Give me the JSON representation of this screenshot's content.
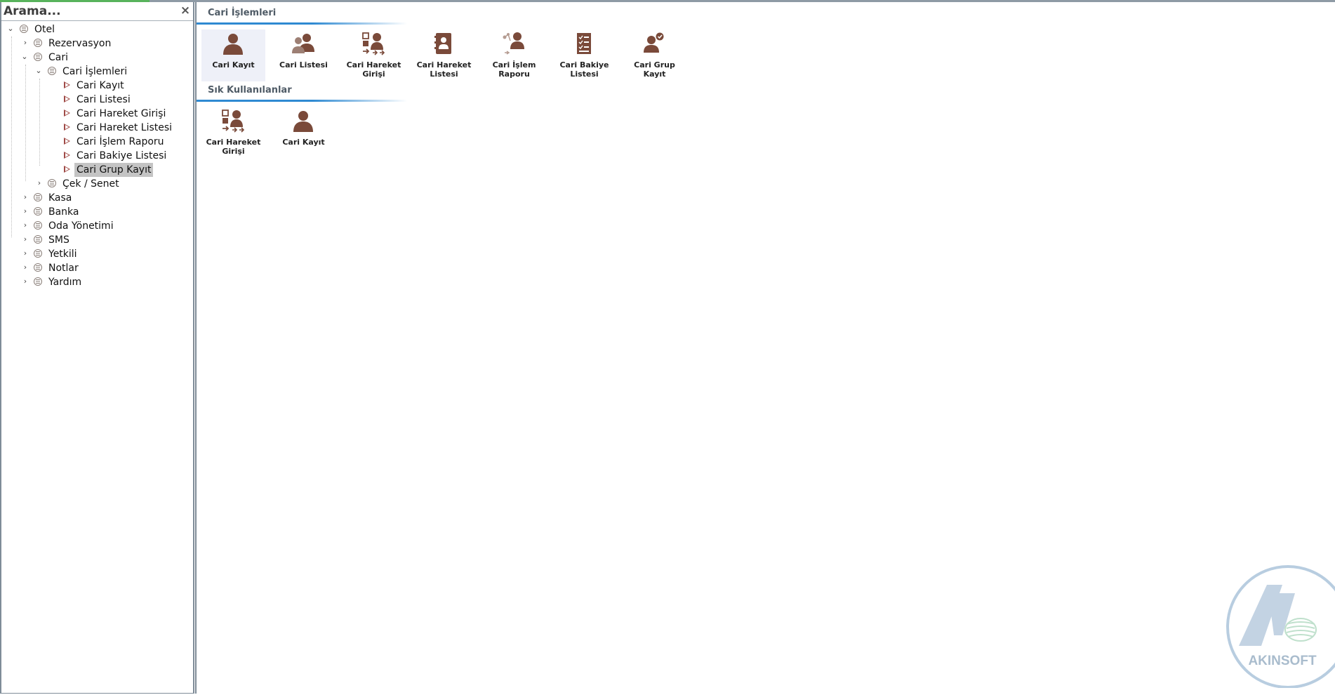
{
  "search": {
    "placeholder": "Arama...",
    "clear_label": "×"
  },
  "tree": {
    "root": "Otel",
    "rezervasyon": "Rezervasyon",
    "cari": "Cari",
    "cari_islemleri": "Cari İşlemleri",
    "leaf_items": [
      "Cari Kayıt",
      "Cari Listesi",
      "Cari Hareket Girişi",
      "Cari Hareket Listesi",
      "Cari İşlem Raporu",
      "Cari Bakiye Listesi",
      "Cari Grup Kayıt"
    ],
    "selected": "Cari Grup Kayıt",
    "cek_senet": "Çek / Senet",
    "top_items": [
      "Kasa",
      "Banka",
      "Oda Yönetimi",
      "SMS",
      "Yetkili",
      "Notlar",
      "Yardım"
    ]
  },
  "main": {
    "section1": {
      "title": "Cari İşlemleri",
      "tiles": [
        {
          "line1": "Cari Kayıt",
          "line2": "",
          "icon": "person-icon"
        },
        {
          "line1": "Cari Listesi",
          "line2": "",
          "icon": "people-icon"
        },
        {
          "line1": "Cari Hareket",
          "line2": "Girişi",
          "icon": "person-transfer-icon"
        },
        {
          "line1": "Cari Hareket",
          "line2": "Listesi",
          "icon": "contact-book-icon"
        },
        {
          "line1": "Cari İşlem",
          "line2": "Raporu",
          "icon": "person-report-icon"
        },
        {
          "line1": "Cari Bakiye",
          "line2": "Listesi",
          "icon": "checklist-icon"
        },
        {
          "line1": "Cari Grup Kayıt",
          "line2": "",
          "icon": "person-check-icon"
        }
      ]
    },
    "section2": {
      "title": "Sık Kullanılanlar",
      "tiles": [
        {
          "line1": "Cari Hareket",
          "line2": "Girişi",
          "icon": "person-transfer-icon"
        },
        {
          "line1": "Cari Kayıt",
          "line2": "",
          "icon": "person-icon"
        }
      ]
    }
  },
  "logo": {
    "text": "AKINSOFT"
  },
  "colors": {
    "icon": "#7a4a3a",
    "accent": "#2f8ad2",
    "selection": "#c4c4c4",
    "tree_leaf": "#a04b47"
  }
}
